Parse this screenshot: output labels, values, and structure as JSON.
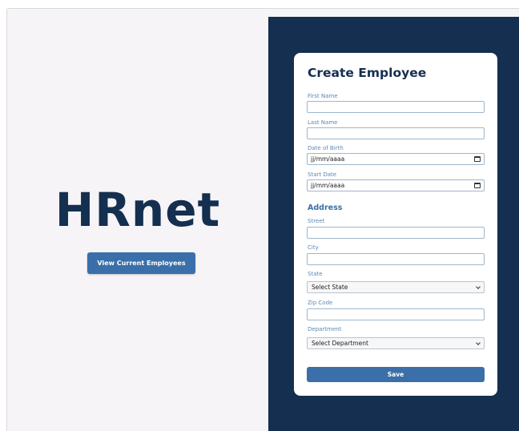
{
  "brand": {
    "title": "HRnet",
    "view_employees_label": "View Current Employees"
  },
  "form": {
    "title": "Create Employee",
    "first_name": {
      "label": "First Name",
      "value": ""
    },
    "last_name": {
      "label": "Last Name",
      "value": ""
    },
    "date_of_birth": {
      "label": "Date of Birth",
      "value": "jj/mm/aaaa",
      "icon": "calendar-icon"
    },
    "start_date": {
      "label": "Start Date",
      "value": "jj/mm/aaaa",
      "icon": "calendar-icon"
    },
    "address_section": "Address",
    "street": {
      "label": "Street",
      "value": ""
    },
    "city": {
      "label": "City",
      "value": ""
    },
    "state": {
      "label": "State",
      "value": "Select State",
      "icon": "chevron-down-icon"
    },
    "zip_code": {
      "label": "Zip Code",
      "value": ""
    },
    "department": {
      "label": "Department",
      "value": "Select Department",
      "icon": "chevron-down-icon"
    },
    "save_label": "Save"
  },
  "colors": {
    "navy": "#142f4f",
    "accent_blue": "#3b6fa9",
    "label_blue": "#5d87b8",
    "left_background": "#f6f4f7",
    "card_background": "#ffffff"
  }
}
